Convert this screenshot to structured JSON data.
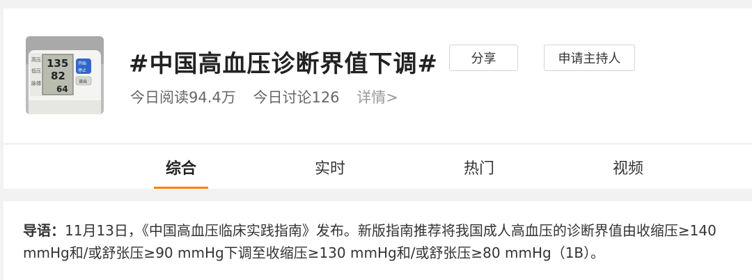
{
  "topic": {
    "title": "#中国高血压诊断界值下调#",
    "stats": {
      "reads": "今日阅读94.4万",
      "discussions": "今日讨论126",
      "detail_link": "详情>"
    },
    "share_label": "分享",
    "apply_host_label": "申请主持人",
    "thumbnail": {
      "monitor_labels": [
        "高压",
        "低压",
        "脉搏"
      ],
      "readings": [
        "135",
        "82",
        "64"
      ],
      "buttons": [
        "开始",
        "停止",
        "读出"
      ]
    }
  },
  "tabs": [
    {
      "label": "综合",
      "active": true
    },
    {
      "label": "实时",
      "active": false
    },
    {
      "label": "热门",
      "active": false
    },
    {
      "label": "视频",
      "active": false
    }
  ],
  "intro": {
    "label": "导语：",
    "text": "11月13日，《中国高血压临床实践指南》发布。新版指南推荐将我国成人高血压的诊断界值由收缩压≥140 mmHg和/或舒张压≥90 mmHg下调至收缩压≥130 mmHg和/或舒张压≥80 mmHg（1B）。"
  },
  "colors": {
    "accent": "#ff8200",
    "page_bg": "#f2f2f2"
  }
}
